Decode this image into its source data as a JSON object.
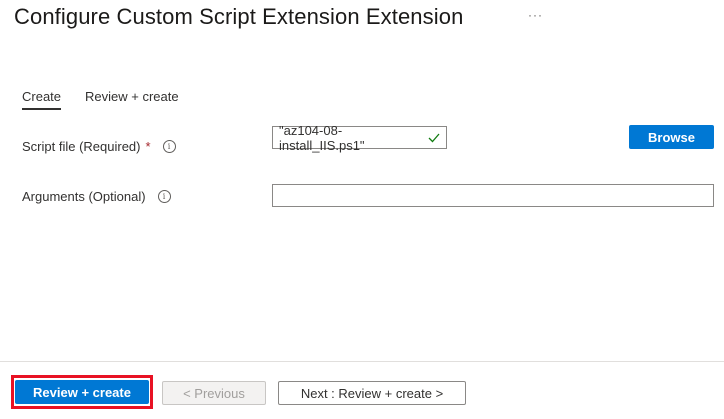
{
  "header": {
    "title": "Configure Custom Script Extension Extension",
    "more_label": "···"
  },
  "tabs": [
    {
      "label": "Create",
      "active": true
    },
    {
      "label": "Review + create",
      "active": false
    }
  ],
  "form": {
    "script_file": {
      "label": "Script file (Required)",
      "required_marker": "*",
      "value": "\"az104-08-install_IIS.ps1\"",
      "valid": true,
      "browse_label": "Browse"
    },
    "arguments": {
      "label": "Arguments (Optional)",
      "value": ""
    },
    "info_glyph": "i"
  },
  "footer": {
    "review_create_label": "Review + create",
    "previous_label": "< Previous",
    "next_label": "Next : Review + create >"
  },
  "colors": {
    "accent": "#0078d4",
    "highlight": "#e81123",
    "valid_check": "#107c10",
    "required": "#a4262c"
  },
  "icons": [
    "more-icon",
    "info-icon",
    "checkmark-icon"
  ]
}
